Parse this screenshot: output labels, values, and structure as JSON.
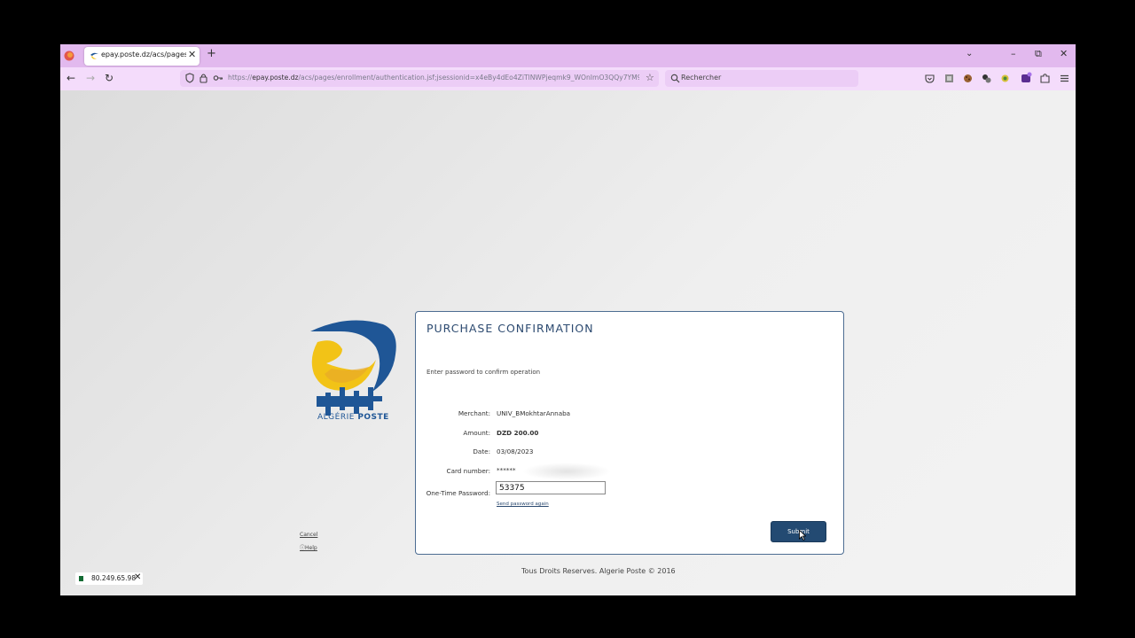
{
  "browser": {
    "tab": {
      "title": "epay.poste.dz/acs/pages/enroll"
    },
    "url": {
      "prefix": "https://",
      "domain": "epay.poste.dz",
      "path": "/acs/pages/enrollment/authentication.jsf;jsessionid=x4eBy4dEo4ZiTlNWPjeqmk9_WOnImO3QQy7YM9V9"
    },
    "search_placeholder": "Rechercher"
  },
  "logo": {
    "line1": "ALGÉRIE",
    "line2": "POSTE"
  },
  "side_links": {
    "cancel": "Cancel",
    "help": "Help"
  },
  "card": {
    "title": "PURCHASE CONFIRMATION",
    "intro": "Enter password to confirm operation",
    "fields": {
      "merchant": {
        "label": "Merchant:",
        "value": "UNIV_BMokhtarAnnaba"
      },
      "amount": {
        "label": "Amount:",
        "value": "DZD 200.00"
      },
      "date": {
        "label": "Date:",
        "value": "03/08/2023"
      },
      "card_number": {
        "label": "Card number:",
        "value": "******"
      },
      "otp": {
        "label": "One-Time Password:",
        "value": "53375"
      }
    },
    "resend": "Send password again",
    "submit": "Submit"
  },
  "footer": "Tous Droits Reserves. Algerie Poste © 2016",
  "ip_badge": "80.249.65.98",
  "colors": {
    "accent": "#234a72",
    "tab_bar": "#e2b9ee",
    "nav_bar": "#f4dcfb"
  },
  "icons": [
    "firefox-icon",
    "favicon-icon",
    "close-icon",
    "plus-icon",
    "chevron-down-icon",
    "minimize-icon",
    "restore-icon",
    "back-icon",
    "forward-icon",
    "reload-icon",
    "shield-icon",
    "lock-icon",
    "key-icon",
    "star-icon",
    "search-icon",
    "pocket-icon",
    "reader-icon",
    "extension-icon",
    "menu-icon",
    "help-icon",
    "cursor-icon",
    "flag-icon"
  ]
}
